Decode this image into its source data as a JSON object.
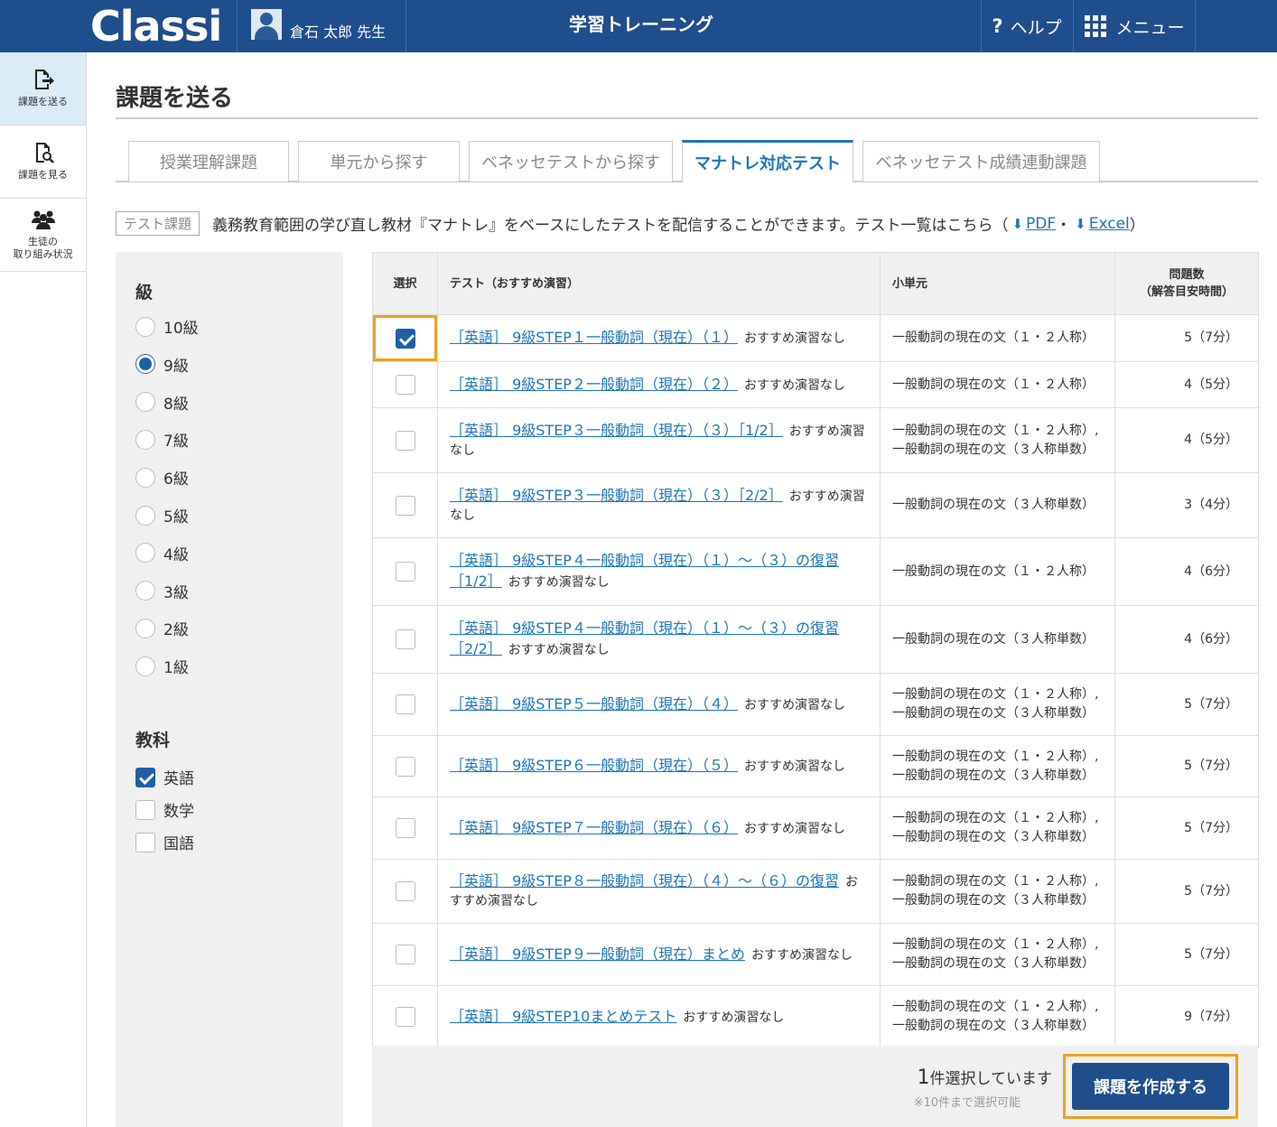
{
  "header": {
    "logo": "Classi",
    "user_name": "倉石 太郎 先生",
    "app_title": "学習トレーニング",
    "help_label": "ヘルプ",
    "help_icon": "?",
    "menu_label": "メニュー"
  },
  "leftnav": [
    {
      "label": "課題を送る",
      "icon": "send-doc-icon"
    },
    {
      "label": "課題を見る",
      "icon": "search-doc-icon"
    },
    {
      "label_line1": "生徒の",
      "label_line2": "取り組み状況",
      "icon": "users-icon"
    }
  ],
  "page": {
    "title": "課題を送る"
  },
  "tabs": [
    "授業理解課題",
    "単元から探す",
    "ベネッセテストから探す",
    "マナトレ対応テスト",
    "ベネッセテスト成績連動課題"
  ],
  "description": {
    "tag": "テスト課題",
    "text": "義務教育範囲の学び直し教材『マナトレ』をベースにしたテストを配信することができます。テスト一覧はこちら（",
    "pdf_label": "PDF",
    "sep": "・",
    "excel_label": "Excel",
    "close": "）"
  },
  "filter": {
    "grade_heading": "級",
    "grades": [
      "10級",
      "9級",
      "8級",
      "7級",
      "6級",
      "5級",
      "4級",
      "3級",
      "2級",
      "1級"
    ],
    "selected_grade": "9級",
    "subject_heading": "教科",
    "subjects": [
      {
        "label": "英語",
        "checked": true
      },
      {
        "label": "数学",
        "checked": false
      },
      {
        "label": "国語",
        "checked": false
      }
    ]
  },
  "table": {
    "headers": {
      "select": "選択",
      "test": "テスト（おすすめ演習）",
      "unit": "小単元",
      "count_line1": "問題数",
      "count_line2": "（解答目安時間）"
    },
    "rows": [
      {
        "checked": true,
        "title": "［英語］ 9級STEP１一般動詞（現在）（１）",
        "note": "おすすめ演習なし",
        "unit": [
          "一般動詞の現在の文（１・２人称）"
        ],
        "count": "5（7分）"
      },
      {
        "checked": false,
        "title": "［英語］ 9級STEP２一般動詞（現在）（２）",
        "note": "おすすめ演習なし",
        "unit": [
          "一般動詞の現在の文（１・２人称）"
        ],
        "count": "4（5分）"
      },
      {
        "checked": false,
        "title": "［英語］ 9級STEP３一般動詞（現在）（３）［1/2］",
        "note": "おすすめ演習なし",
        "unit": [
          "一般動詞の現在の文（１・２人称）,",
          "一般動詞の現在の文（３人称単数）"
        ],
        "count": "4（5分）"
      },
      {
        "checked": false,
        "title": "［英語］ 9級STEP３一般動詞（現在）（３）［2/2］",
        "note": "おすすめ演習なし",
        "unit": [
          "一般動詞の現在の文（３人称単数）"
        ],
        "count": "3（4分）"
      },
      {
        "checked": false,
        "title": "［英語］ 9級STEP４一般動詞（現在）（１）～（３）の復習［1/2］",
        "note": "おすすめ演習なし",
        "unit": [
          "一般動詞の現在の文（１・２人称）"
        ],
        "count": "4（6分）"
      },
      {
        "checked": false,
        "title": "［英語］ 9級STEP４一般動詞（現在）（１）～（３）の復習［2/2］",
        "note": "おすすめ演習なし",
        "unit": [
          "一般動詞の現在の文（３人称単数）"
        ],
        "count": "4（6分）"
      },
      {
        "checked": false,
        "title": "［英語］ 9級STEP５一般動詞（現在）（４）",
        "note": "おすすめ演習なし",
        "unit": [
          "一般動詞の現在の文（１・２人称）,",
          "一般動詞の現在の文（３人称単数）"
        ],
        "count": "5（7分）"
      },
      {
        "checked": false,
        "title": "［英語］ 9級STEP６一般動詞（現在）（５）",
        "note": "おすすめ演習なし",
        "unit": [
          "一般動詞の現在の文（１・２人称）,",
          "一般動詞の現在の文（３人称単数）"
        ],
        "count": "5（7分）"
      },
      {
        "checked": false,
        "title": "［英語］ 9級STEP７一般動詞（現在）（６）",
        "note": "おすすめ演習なし",
        "unit": [
          "一般動詞の現在の文（１・２人称）,",
          "一般動詞の現在の文（３人称単数）"
        ],
        "count": "5（7分）"
      },
      {
        "checked": false,
        "title": "［英語］ 9級STEP８一般動詞（現在）（４）～（６）の復習",
        "note": "おすすめ演習なし",
        "unit": [
          "一般動詞の現在の文（１・２人称）,",
          "一般動詞の現在の文（３人称単数）"
        ],
        "count": "5（7分）"
      },
      {
        "checked": false,
        "title": "［英語］ 9級STEP９一般動詞（現在）まとめ",
        "note": "おすすめ演習なし",
        "unit": [
          "一般動詞の現在の文（１・２人称）,",
          "一般動詞の現在の文（３人称単数）"
        ],
        "count": "5（7分）"
      },
      {
        "checked": false,
        "title": "［英語］ 9級STEP10まとめテスト",
        "note": "おすすめ演習なし",
        "unit": [
          "一般動詞の現在の文（１・２人称）,",
          "一般動詞の現在の文（３人称単数）"
        ],
        "count": "9（7分）"
      }
    ]
  },
  "footer": {
    "selected_num": "1",
    "selected_text": "件選択しています",
    "limit_note": "※10件まで選択可能",
    "create_label": "課題を作成する"
  },
  "colors": {
    "header_bg": "#1f4e8c",
    "accent": "#1f74b8",
    "highlight": "#f0a020"
  }
}
